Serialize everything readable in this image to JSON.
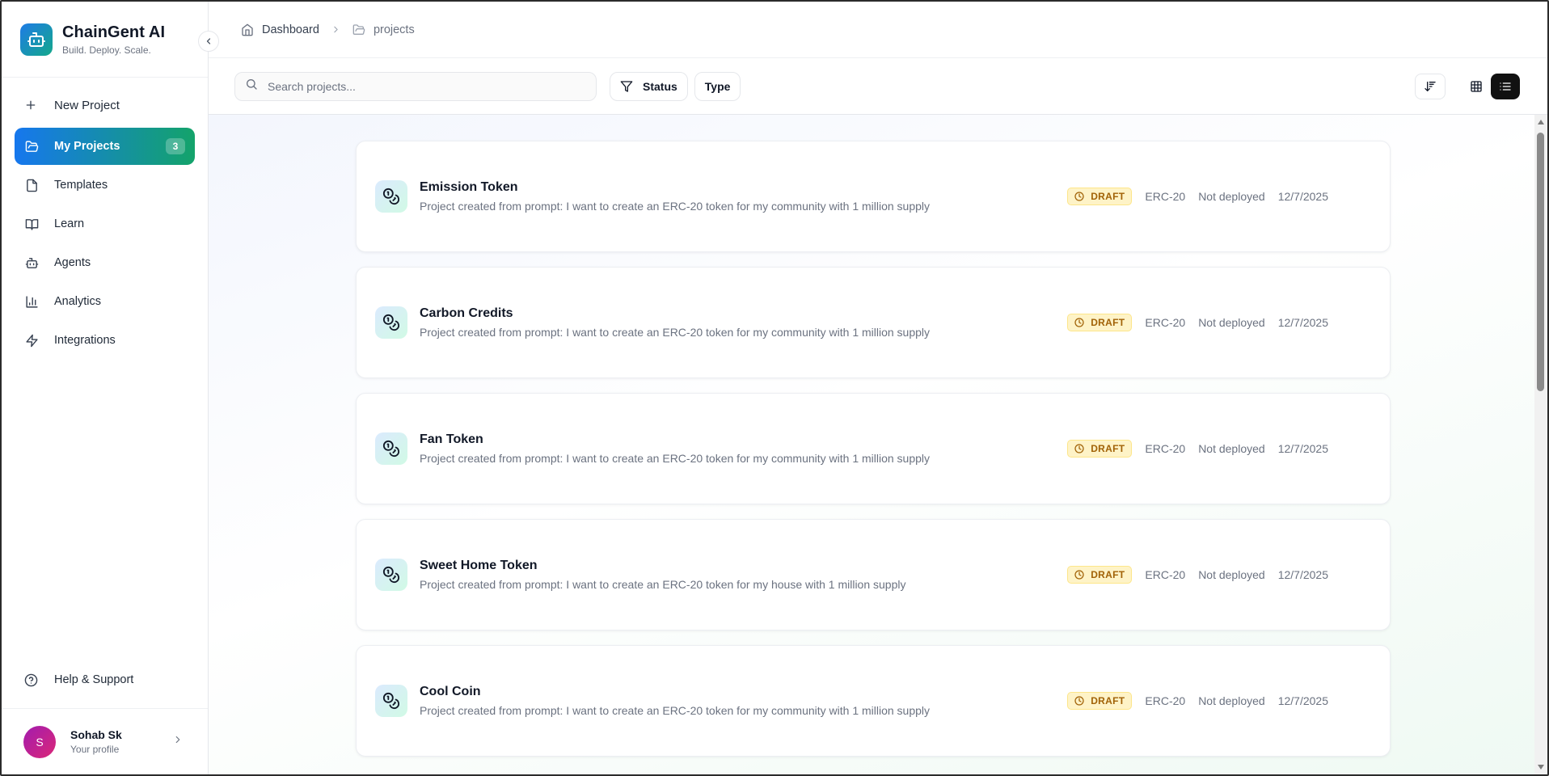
{
  "brand": {
    "title": "ChainGent AI",
    "subtitle": "Build. Deploy. Scale."
  },
  "sidebar": {
    "new_project": "New Project",
    "items": [
      {
        "label": "My Projects",
        "icon": "folder-open-icon",
        "badge": "3",
        "active": true
      },
      {
        "label": "Templates",
        "icon": "file-icon"
      },
      {
        "label": "Learn",
        "icon": "book-open-icon"
      },
      {
        "label": "Agents",
        "icon": "bot-icon"
      },
      {
        "label": "Analytics",
        "icon": "bar-chart-icon"
      },
      {
        "label": "Integrations",
        "icon": "zap-icon"
      }
    ],
    "help": "Help & Support",
    "profile": {
      "initial": "S",
      "name": "Sohab Sk",
      "subtitle": "Your profile"
    }
  },
  "breadcrumb": {
    "home": "Dashboard",
    "current": "projects"
  },
  "toolbar": {
    "search_placeholder": "Search projects...",
    "status_label": "Status",
    "type_label": "Type"
  },
  "projects": [
    {
      "name": "Emission Token",
      "description": "Project created from prompt: I want to create an ERC-20 token for my community with 1 million supply",
      "status": "DRAFT",
      "type": "ERC-20",
      "deployment": "Not deployed",
      "date": "12/7/2025"
    },
    {
      "name": "Carbon Credits",
      "description": "Project created from prompt: I want to create an ERC-20 token for my community with 1 million supply",
      "status": "DRAFT",
      "type": "ERC-20",
      "deployment": "Not deployed",
      "date": "12/7/2025"
    },
    {
      "name": "Fan Token",
      "description": "Project created from prompt: I want to create an ERC-20 token for my community with 1 million supply",
      "status": "DRAFT",
      "type": "ERC-20",
      "deployment": "Not deployed",
      "date": "12/7/2025"
    },
    {
      "name": "Sweet Home Token",
      "description": "Project created from prompt: I want to create an ERC-20 token for my house with 1 million supply",
      "status": "DRAFT",
      "type": "ERC-20",
      "deployment": "Not deployed",
      "date": "12/7/2025"
    },
    {
      "name": "Cool Coin",
      "description": "Project created from prompt: I want to create an ERC-20 token for my community with 1 million supply",
      "status": "DRAFT",
      "type": "ERC-20",
      "deployment": "Not deployed",
      "date": "12/7/2025"
    }
  ],
  "colors": {
    "accent_blue": "#1677ee",
    "accent_green": "#14a36a",
    "draft_bg": "#fef3c7",
    "draft_text": "#a16207"
  }
}
